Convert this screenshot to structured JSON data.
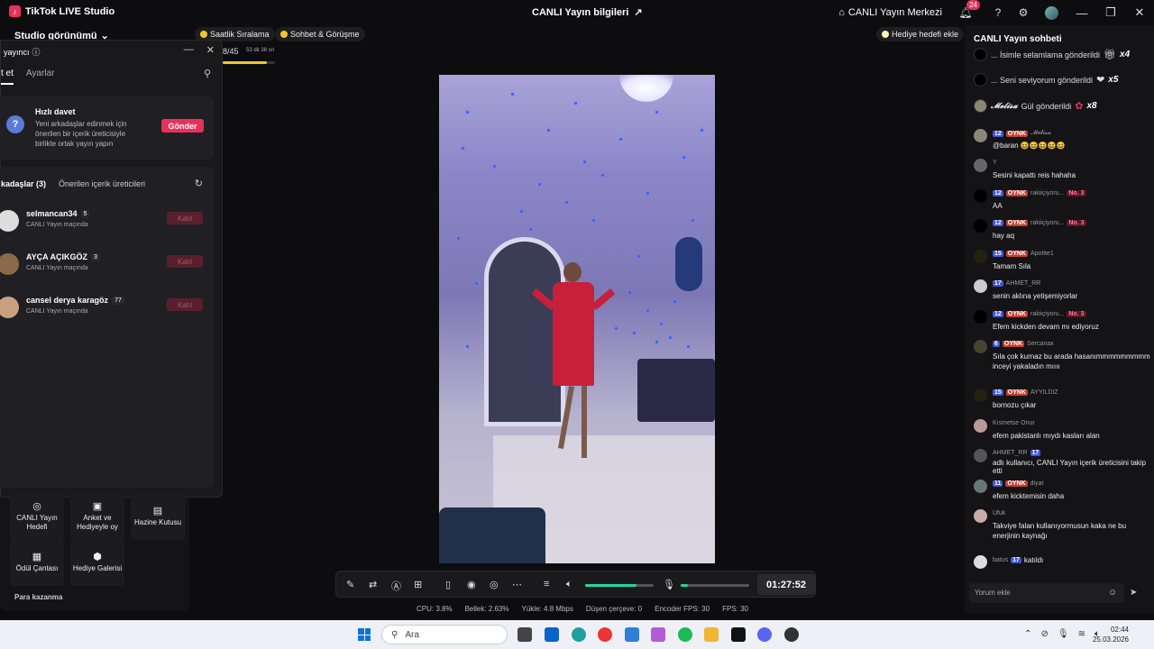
{
  "app": {
    "title": "TikTok LIVE Studio",
    "center_title": "CANLI Yayın bilgileri",
    "live_center": "CANLI Yayın Merkezi",
    "notification_count": "24"
  },
  "studio": {
    "view_label": "Studio görünümü"
  },
  "chips": {
    "hourly": "Saatlik Sıralama",
    "chat_meet": "Sohbet & Görüşme",
    "gift_goal": "Hediye hedefi ekle"
  },
  "progress": {
    "count": "8/45",
    "time": "53 dk 38 sn",
    "fraction": 0.85
  },
  "popup": {
    "title": "yayıncı",
    "tabs": [
      "t et",
      "Ayarlar"
    ],
    "invite": {
      "title": "Hızlı davet",
      "desc": "Yeni arkadaşlar edinmek için önerilen bir içerik üreticisiyle birlikte ortak yayın yapın",
      "button": "Gönder"
    },
    "list_tabs": [
      "kadaşlar (3)",
      "Önerilen içerik üreticileri"
    ],
    "friends": [
      {
        "name": "selmancan34",
        "count": "5",
        "status": "CANLI Yayın maçında",
        "join": "Katıl"
      },
      {
        "name": "AYÇA AÇIKGÖZ",
        "count": "3",
        "status": "CANLI Yayın maçında",
        "join": "Katıl"
      },
      {
        "name": "cansel derya karagöz",
        "count": "77",
        "status": "CANLI Yayın maçında",
        "join": "Katıl"
      }
    ]
  },
  "tools": {
    "goal": "CANLI Yayın Hedefi",
    "poll": "Anket ve Hediyeyle oy",
    "treasure": "Hazine Kutusu",
    "bag": "Ödül Çantası",
    "gallery": "Hediye Galerisi",
    "earn": "Para kazanma"
  },
  "controls": {
    "timer": "01:27:52",
    "volume": 0.75,
    "mic": 0.1
  },
  "stats": {
    "cpu": "CPU: 3.8%",
    "mem": "Bellek: 2.63%",
    "upload": "Yükle: 4.8 Mbps",
    "dropped": "Düşen çerçeve: 0",
    "encoder_fps": "Encoder FPS: 30",
    "fps": "FPS: 30"
  },
  "chat": {
    "header": "CANLI Yayın sohbeti",
    "pinned": [
      {
        "text": "... İsimle selamlama gönderildi",
        "mult": "x4"
      },
      {
        "text": "... Seni seviyorum gönderildi",
        "mult": "x5"
      },
      {
        "user": "𝓜𝓮𝓵𝓲𝓼𝓪",
        "text": "Gül gönderildi",
        "mult": "x8"
      }
    ],
    "messages": [
      {
        "lvl": "12",
        "oynk": "OYNK",
        "user": "𝓜𝓮𝓵𝓲𝓼𝓪",
        "text": "@baran 😆😆😆😆😆"
      },
      {
        "user": "Y",
        "text": "Sesini kapattı reis hahaha"
      },
      {
        "lvl": "12",
        "oynk": "OYNK",
        "user": "rakiiçiyoru...",
        "no": "No. 3",
        "text": "AA"
      },
      {
        "lvl": "12",
        "oynk": "OYNK",
        "user": "rakiiçiyoru...",
        "no": "No. 3",
        "text": "hay aq"
      },
      {
        "lvl": "15",
        "oynk": "OYNK",
        "user": "Apotite1",
        "text": "Tamam Sıla"
      },
      {
        "lvl": "17",
        "user": "AHMET_RR",
        "text": "senin aklına yetişemiyorlar"
      },
      {
        "lvl": "12",
        "oynk": "OYNK",
        "user": "rakiiçiyoru...",
        "no": "No. 3",
        "text": "Efem kickden devam mı ediyoruz"
      },
      {
        "lvl": "6",
        "oynk": "OYNK",
        "user": "Sercanax",
        "text": "Sıla çok kurnaz bu arada hasanımmmmmmmmm inceyi yakaladın mıııı"
      },
      {
        "lvl": "15",
        "oynk": "OYNK",
        "user": "AYYILDIZ",
        "text": "bornozu çıkar"
      },
      {
        "user": "Kısmetse Onur",
        "text": "efem pakistanlı mıydı kasları alan"
      },
      {
        "user": "AHMET_RR",
        "lvl": "17",
        "text": "adlı kullanıcı, CANLI Yayın içerik üreticisini takip etti"
      },
      {
        "lvl": "11",
        "oynk": "OYNK",
        "user": "diyar",
        "text": "efem kicktemisin daha"
      },
      {
        "user": "Ufuk",
        "text": "Takviye falan kullanıyormusun kaka ne bu enerjinin kaynağı"
      },
      {
        "user": "batus",
        "lvl": "17",
        "text": "katıldı"
      }
    ],
    "input_placeholder": "Yorum ekle"
  },
  "taskbar": {
    "search": "Ara",
    "time": "02:44",
    "date": "25.03.2026"
  }
}
